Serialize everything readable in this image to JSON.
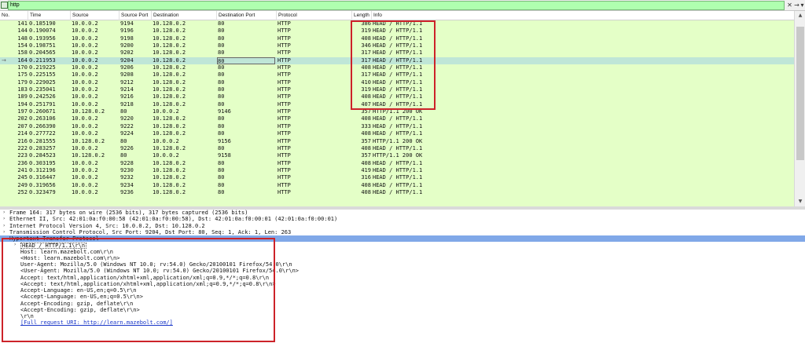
{
  "filter": {
    "value": "http",
    "clear_glyph": "✕",
    "apply_glyph": "→",
    "dropdown_glyph": "▾",
    "icon": "bookmark-icon"
  },
  "columns": [
    "No.",
    "Time",
    "Source",
    "Source Port",
    "Destination",
    "Destination Port",
    "Protocol",
    "Length",
    "Info"
  ],
  "packets": [
    {
      "no": "141",
      "time": "0.185190",
      "src": "10.0.0.2",
      "sport": "9194",
      "dst": "10.128.0.2",
      "dport": "80",
      "proto": "HTTP",
      "len": "386",
      "info": "HEAD / HTTP/1.1"
    },
    {
      "no": "144",
      "time": "0.190074",
      "src": "10.0.0.2",
      "sport": "9196",
      "dst": "10.128.0.2",
      "dport": "80",
      "proto": "HTTP",
      "len": "319",
      "info": "HEAD / HTTP/1.1"
    },
    {
      "no": "148",
      "time": "0.193956",
      "src": "10.0.0.2",
      "sport": "9198",
      "dst": "10.128.0.2",
      "dport": "80",
      "proto": "HTTP",
      "len": "408",
      "info": "HEAD / HTTP/1.1"
    },
    {
      "no": "154",
      "time": "0.198751",
      "src": "10.0.0.2",
      "sport": "9200",
      "dst": "10.128.0.2",
      "dport": "80",
      "proto": "HTTP",
      "len": "346",
      "info": "HEAD / HTTP/1.1"
    },
    {
      "no": "158",
      "time": "0.204565",
      "src": "10.0.0.2",
      "sport": "9202",
      "dst": "10.128.0.2",
      "dport": "80",
      "proto": "HTTP",
      "len": "317",
      "info": "HEAD / HTTP/1.1"
    },
    {
      "no": "164",
      "time": "0.211953",
      "src": "10.0.0.2",
      "sport": "9204",
      "dst": "10.128.0.2",
      "dport": "80",
      "proto": "HTTP",
      "len": "317",
      "info": "HEAD / HTTP/1.1",
      "selected": true
    },
    {
      "no": "170",
      "time": "0.219225",
      "src": "10.0.0.2",
      "sport": "9206",
      "dst": "10.128.0.2",
      "dport": "80",
      "proto": "HTTP",
      "len": "408",
      "info": "HEAD / HTTP/1.1"
    },
    {
      "no": "175",
      "time": "0.225155",
      "src": "10.0.0.2",
      "sport": "9208",
      "dst": "10.128.0.2",
      "dport": "80",
      "proto": "HTTP",
      "len": "317",
      "info": "HEAD / HTTP/1.1"
    },
    {
      "no": "179",
      "time": "0.229025",
      "src": "10.0.0.2",
      "sport": "9212",
      "dst": "10.128.0.2",
      "dport": "80",
      "proto": "HTTP",
      "len": "410",
      "info": "HEAD / HTTP/1.1"
    },
    {
      "no": "183",
      "time": "0.235041",
      "src": "10.0.0.2",
      "sport": "9214",
      "dst": "10.128.0.2",
      "dport": "80",
      "proto": "HTTP",
      "len": "319",
      "info": "HEAD / HTTP/1.1"
    },
    {
      "no": "189",
      "time": "0.242526",
      "src": "10.0.0.2",
      "sport": "9216",
      "dst": "10.128.0.2",
      "dport": "80",
      "proto": "HTTP",
      "len": "408",
      "info": "HEAD / HTTP/1.1"
    },
    {
      "no": "194",
      "time": "0.251791",
      "src": "10.0.0.2",
      "sport": "9218",
      "dst": "10.128.0.2",
      "dport": "80",
      "proto": "HTTP",
      "len": "407",
      "info": "HEAD / HTTP/1.1"
    },
    {
      "no": "197",
      "time": "0.260671",
      "src": "10.128.0.2",
      "sport": "80",
      "dst": "10.0.0.2",
      "dport": "9146",
      "proto": "HTTP",
      "len": "357",
      "info": "HTTP/1.1 200 OK"
    },
    {
      "no": "202",
      "time": "0.263106",
      "src": "10.0.0.2",
      "sport": "9220",
      "dst": "10.128.0.2",
      "dport": "80",
      "proto": "HTTP",
      "len": "408",
      "info": "HEAD / HTTP/1.1"
    },
    {
      "no": "207",
      "time": "0.266390",
      "src": "10.0.0.2",
      "sport": "9222",
      "dst": "10.128.0.2",
      "dport": "80",
      "proto": "HTTP",
      "len": "333",
      "info": "HEAD / HTTP/1.1"
    },
    {
      "no": "214",
      "time": "0.277722",
      "src": "10.0.0.2",
      "sport": "9224",
      "dst": "10.128.0.2",
      "dport": "80",
      "proto": "HTTP",
      "len": "408",
      "info": "HEAD / HTTP/1.1"
    },
    {
      "no": "216",
      "time": "0.281555",
      "src": "10.128.0.2",
      "sport": "80",
      "dst": "10.0.0.2",
      "dport": "9156",
      "proto": "HTTP",
      "len": "357",
      "info": "HTTP/1.1 200 OK"
    },
    {
      "no": "222",
      "time": "0.283257",
      "src": "10.0.0.2",
      "sport": "9226",
      "dst": "10.128.0.2",
      "dport": "80",
      "proto": "HTTP",
      "len": "408",
      "info": "HEAD / HTTP/1.1"
    },
    {
      "no": "223",
      "time": "0.284523",
      "src": "10.128.0.2",
      "sport": "80",
      "dst": "10.0.0.2",
      "dport": "9158",
      "proto": "HTTP",
      "len": "357",
      "info": "HTTP/1.1 200 OK"
    },
    {
      "no": "236",
      "time": "0.303195",
      "src": "10.0.0.2",
      "sport": "9228",
      "dst": "10.128.0.2",
      "dport": "80",
      "proto": "HTTP",
      "len": "408",
      "info": "HEAD / HTTP/1.1"
    },
    {
      "no": "241",
      "time": "0.312196",
      "src": "10.0.0.2",
      "sport": "9230",
      "dst": "10.128.0.2",
      "dport": "80",
      "proto": "HTTP",
      "len": "419",
      "info": "HEAD / HTTP/1.1"
    },
    {
      "no": "245",
      "time": "0.316447",
      "src": "10.0.0.2",
      "sport": "9232",
      "dst": "10.128.0.2",
      "dport": "80",
      "proto": "HTTP",
      "len": "316",
      "info": "HEAD / HTTP/1.1"
    },
    {
      "no": "249",
      "time": "0.319656",
      "src": "10.0.0.2",
      "sport": "9234",
      "dst": "10.128.0.2",
      "dport": "80",
      "proto": "HTTP",
      "len": "408",
      "info": "HEAD / HTTP/1.1"
    },
    {
      "no": "252",
      "time": "0.323479",
      "src": "10.0.0.2",
      "sport": "9236",
      "dst": "10.128.0.2",
      "dport": "80",
      "proto": "HTTP",
      "len": "408",
      "info": "HEAD / HTTP/1.1"
    }
  ],
  "details": [
    {
      "level": 0,
      "expander": "›",
      "text": "Frame 164: 317 bytes on wire (2536 bits), 317 bytes captured (2536 bits)"
    },
    {
      "level": 0,
      "expander": "›",
      "text": "Ethernet II, Src: 42:01:0a:f0:00:58 (42:01:0a:f0:00:58), Dst: 42:01:0a:f0:00:01 (42:01:0a:f0:00:01)"
    },
    {
      "level": 0,
      "expander": "›",
      "text": "Internet Protocol Version 4, Src: 10.0.0.2, Dst: 10.128.0.2"
    },
    {
      "level": 0,
      "expander": "›",
      "text": "Transmission Control Protocol, Src Port: 9204, Dst Port: 80, Seq: 1, Ack: 1, Len: 263"
    },
    {
      "level": 0,
      "expander": "⌄",
      "text": "Hypertext Transfer Protocol",
      "highlight": true
    },
    {
      "level": 1,
      "expander": "›",
      "text": "HEAD / HTTP/1.1\\r\\n",
      "boxed": true
    },
    {
      "level": 1,
      "text": "Host: learn.mazebolt.com\\r\\n"
    },
    {
      "level": 1,
      "text": "<Host: learn.mazebolt.com\\r\\n>"
    },
    {
      "level": 1,
      "text": "User-Agent: Mozilla/5.0 (Windows NT 10.0; rv:54.0) Gecko/20100101 Firefox/54.0\\r\\n"
    },
    {
      "level": 1,
      "text": "<User-Agent: Mozilla/5.0 (Windows NT 10.0; rv:54.0) Gecko/20100101 Firefox/54.0\\r\\n>"
    },
    {
      "level": 1,
      "text": "Accept: text/html,application/xhtml+xml,application/xml;q=0.9,*/*;q=0.8\\r\\n"
    },
    {
      "level": 1,
      "text": "<Accept: text/html,application/xhtml+xml,application/xml;q=0.9,*/*;q=0.8\\r\\n>"
    },
    {
      "level": 1,
      "text": "Accept-Language: en-US,en;q=0.5\\r\\n"
    },
    {
      "level": 1,
      "text": "<Accept-Language: en-US,en;q=0.5\\r\\n>"
    },
    {
      "level": 1,
      "text": "Accept-Encoding: gzip, deflate\\r\\n"
    },
    {
      "level": 1,
      "text": "<Accept-Encoding: gzip, deflate\\r\\n>"
    },
    {
      "level": 1,
      "text": "\\r\\n"
    },
    {
      "level": 1,
      "text": "[Full request URI: http://learn.mazebolt.com/]",
      "link": true
    }
  ],
  "selected_marker": "→",
  "colors": {
    "row_bg": "#e4ffc7",
    "selected_row": "#bfe6d7",
    "filter_bg": "#afffaf",
    "highlight": "#80a8e8",
    "annotation": "#cc2229",
    "link": "#1a37c8"
  }
}
